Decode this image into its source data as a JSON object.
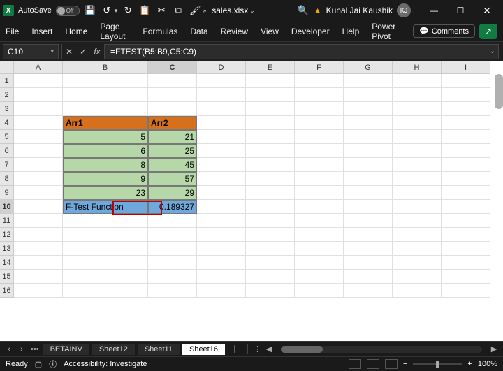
{
  "titlebar": {
    "autosave_label": "AutoSave",
    "autosave_state": "Off",
    "filename": "sales.xlsx",
    "user_name": "Kunal Jai Kaushik",
    "user_initials": "KJ"
  },
  "ribbon": {
    "tabs": [
      "File",
      "Insert",
      "Home",
      "Page Layout",
      "Formulas",
      "Data",
      "Review",
      "View",
      "Developer",
      "Help",
      "Power Pivot"
    ],
    "comments_label": "Comments"
  },
  "formula_bar": {
    "name_box": "C10",
    "formula": "=FTEST(B5:B9,C5:C9)"
  },
  "columns": [
    "A",
    "B",
    "C",
    "D",
    "E",
    "F",
    "G",
    "H",
    "I"
  ],
  "rows": [
    "1",
    "2",
    "3",
    "4",
    "5",
    "6",
    "7",
    "8",
    "9",
    "10",
    "11",
    "12",
    "13",
    "14",
    "15",
    "16"
  ],
  "selected_col": "C",
  "selected_row": "10",
  "cells": {
    "B4": "Arr1",
    "C4": "Arr2",
    "B5": "5",
    "C5": "21",
    "B6": "6",
    "C6": "25",
    "B7": "8",
    "C7": "45",
    "B8": "9",
    "C8": "57",
    "B9": "23",
    "C9": "29",
    "B10": "F-Test Function",
    "C10": "0.189327"
  },
  "sheet_tabs": {
    "tabs": [
      "BETAINV",
      "Sheet12",
      "Sheet11",
      "Sheet16"
    ],
    "active": "Sheet16"
  },
  "status": {
    "ready": "Ready",
    "accessibility": "Accessibility: Investigate",
    "zoom": "100%"
  },
  "chart_data": {
    "type": "table",
    "title": "F-Test Function",
    "columns": [
      "Arr1",
      "Arr2"
    ],
    "rows": [
      [
        5,
        21
      ],
      [
        6,
        25
      ],
      [
        8,
        45
      ],
      [
        9,
        57
      ],
      [
        23,
        29
      ]
    ],
    "result_label": "F-Test Function",
    "result_value": 0.189327,
    "formula": "=FTEST(B5:B9,C5:C9)"
  }
}
